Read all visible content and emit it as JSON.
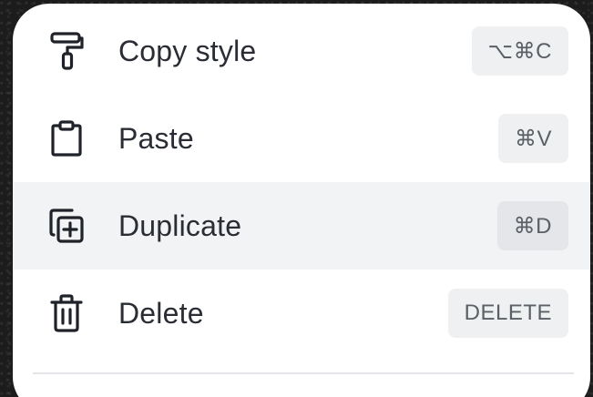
{
  "menu": {
    "items": [
      {
        "label": "Copy style",
        "shortcut": "⌥⌘C",
        "icon": "paint-roller-icon",
        "highlighted": false
      },
      {
        "label": "Paste",
        "shortcut": "⌘V",
        "icon": "clipboard-icon",
        "highlighted": false
      },
      {
        "label": "Duplicate",
        "shortcut": "⌘D",
        "icon": "duplicate-icon",
        "highlighted": true
      },
      {
        "label": "Delete",
        "shortcut": "DELETE",
        "icon": "trash-icon",
        "highlighted": false
      }
    ]
  },
  "colors": {
    "background": "#1c1c1c",
    "menu_background": "#ffffff",
    "highlight": "#f2f3f5",
    "text": "#2a2d34",
    "shortcut_background": "#eef0f2",
    "shortcut_text": "#5b5f66"
  }
}
